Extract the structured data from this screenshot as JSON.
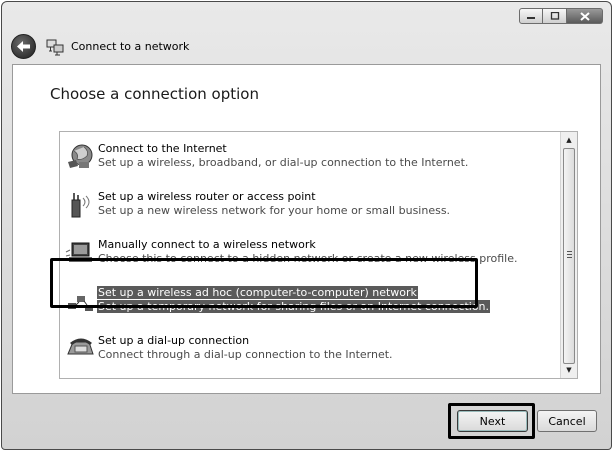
{
  "window": {
    "title": "Connect to a network",
    "controls": [
      "minimize",
      "maximize",
      "close"
    ]
  },
  "heading": "Choose a connection option",
  "options": [
    {
      "title": "Connect to the Internet",
      "description": "Set up a wireless, broadband, or dial-up connection to the Internet.",
      "icon": "globe-network-icon",
      "selected": false
    },
    {
      "title": "Set up a wireless router or access point",
      "description": "Set up a new wireless network for your home or small business.",
      "icon": "wireless-router-icon",
      "selected": false
    },
    {
      "title": "Manually connect to a wireless network",
      "description": "Choose this to connect to a hidden network or create a new wireless profile.",
      "icon": "wireless-computer-icon",
      "selected": false
    },
    {
      "title": "Set up a wireless ad hoc (computer-to-computer) network",
      "description": "Set up a temporary network for sharing files or an Internet connection.",
      "icon": "adhoc-network-icon",
      "selected": true
    },
    {
      "title": "Set up a dial-up connection",
      "description": "Connect through a dial-up connection to the Internet.",
      "icon": "phone-modem-icon",
      "selected": false
    }
  ],
  "buttons": {
    "next": "Next",
    "cancel": "Cancel"
  }
}
